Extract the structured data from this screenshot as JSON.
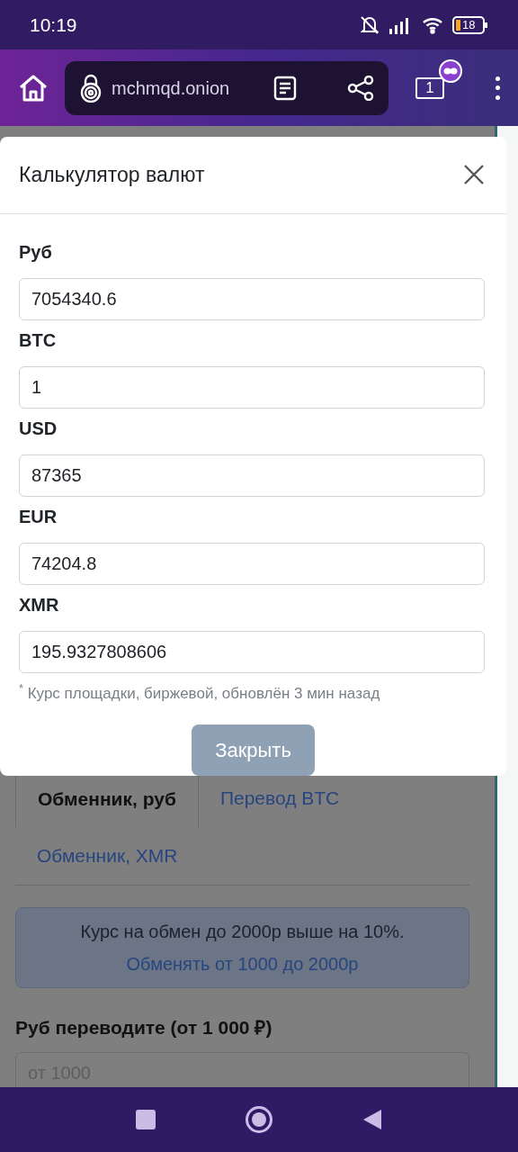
{
  "status_bar": {
    "time": "10:19",
    "battery": "18"
  },
  "browser": {
    "url": "mchmqd.onion",
    "tab_count": "1"
  },
  "dialog": {
    "title": "Калькулятор валют",
    "fields": [
      {
        "label": "Руб",
        "value": "7054340.6"
      },
      {
        "label": "BTC",
        "value": "1"
      },
      {
        "label": "USD",
        "value": "87365"
      },
      {
        "label": "EUR",
        "value": "74204.8"
      },
      {
        "label": "XMR",
        "value": "195.9327808606"
      }
    ],
    "note": "$^{*}$ Курс площадки, биржевой, обновлён 3 мин назад",
    "close_button": {
      "label": "Закрыть",
      "disabled": true
    }
  },
  "page": {
    "tabs": [
      {
        "label": "Обменник, руб",
        "selected": true
      },
      {
        "label": "Перевод BTC",
        "selected": false
      },
      {
        "label": "Обменник, XMR",
        "selected": false
      }
    ],
    "notice": {
      "text": "Курс на обмен до 2000р выше на 10%.",
      "link": "Обменять от 1000 до 2000р"
    },
    "amount_field": {
      "label": "Руб переводите (от 1 000 ₽)",
      "placeholder": "от 1000"
    }
  }
}
